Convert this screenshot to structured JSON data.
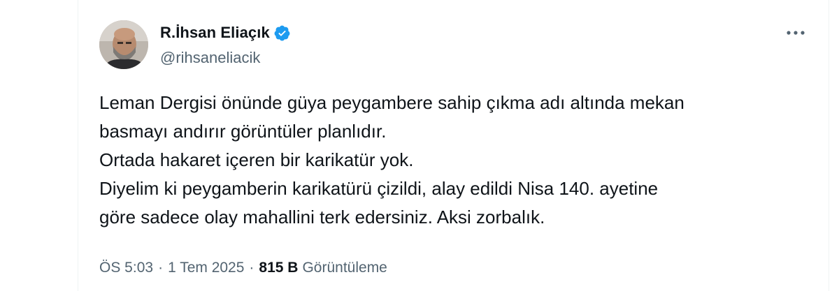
{
  "author": {
    "display_name": "R.İhsan Eliaçık",
    "handle": "@rihsaneliacik",
    "verified": true,
    "verified_color": "#1d9bf0"
  },
  "tweet": {
    "lines": [
      "Leman Dergisi önünde güya peygambere sahip çıkma adı altında mekan",
      "basmayı andırır görüntüler planlıdır.",
      "Ortada hakaret içeren bir karikatür yok.",
      "Diyelim ki peygamberin karikatürü çizildi, alay edildi Nisa 140. ayetine",
      "göre sadece olay mahallini terk edersiniz. Aksi zorbalık."
    ]
  },
  "meta": {
    "time": "ÖS 5:03",
    "separator": "·",
    "date": "1 Tem 2025",
    "views_count": "815 B",
    "views_label": "Görüntüleme"
  },
  "icons": {
    "more": "more-horizontal-icon",
    "verified": "verified-badge-icon"
  },
  "colors": {
    "text_primary": "#0f1419",
    "text_secondary": "#536471",
    "accent": "#1d9bf0"
  }
}
